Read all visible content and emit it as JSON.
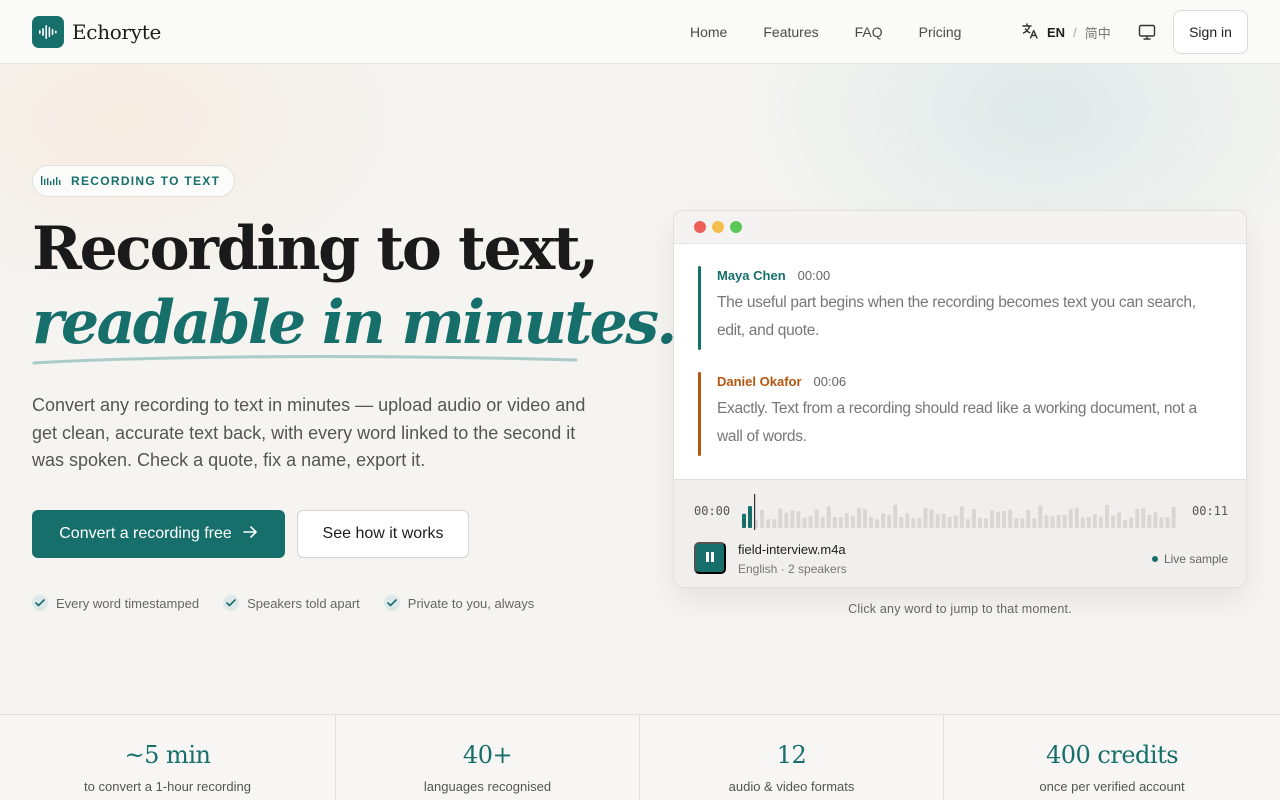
{
  "nav": {
    "brand": "Echoryte",
    "links": [
      "Home",
      "Features",
      "FAQ",
      "Pricing"
    ],
    "lang_active": "EN",
    "lang_separator": "/",
    "lang_alt": "简中",
    "signin": "Sign in"
  },
  "hero": {
    "badge": "RECORDING TO TEXT",
    "title_line1": "Recording to text,",
    "title_line2": "readable in minutes.",
    "lede": "Convert any recording to text in minutes — upload audio or video and get clean, accurate text back, with every word linked to the second it was spoken. Check a quote, fix a name, export it.",
    "cta_primary": "Convert a recording free",
    "cta_secondary": "See how it works",
    "checks": [
      "Every word timestamped",
      "Speakers told apart",
      "Private to you, always"
    ]
  },
  "demo": {
    "segments": [
      {
        "speaker": "Maya Chen",
        "time": "00:00",
        "text": "The useful part begins when the recording becomes text you can search, edit, and quote.",
        "color": "#176f6c"
      },
      {
        "speaker": "Daniel Okafor",
        "time": "00:06",
        "text": "Exactly. Text from a recording should read like a working document, not a wall of words.",
        "color": "#b5560f"
      }
    ],
    "time_start": "00:00",
    "time_end": "00:11",
    "file_name": "field-interview.m4a",
    "file_meta": "English · 2 speakers",
    "live_label": "Live sample",
    "caption": "Click any word to jump to that moment."
  },
  "stats": [
    {
      "value": "~5 min",
      "label": "to convert a 1-hour recording"
    },
    {
      "value": "40+",
      "label": "languages recognised"
    },
    {
      "value": "12",
      "label": "audio & video formats"
    },
    {
      "value": "400 credits",
      "label": "once per verified account"
    }
  ],
  "colors": {
    "accent": "#176f6c",
    "speaker2": "#b5560f",
    "dot_red": "#ee5f57",
    "dot_yellow": "#f4bd4f",
    "dot_green": "#5cc85a"
  }
}
